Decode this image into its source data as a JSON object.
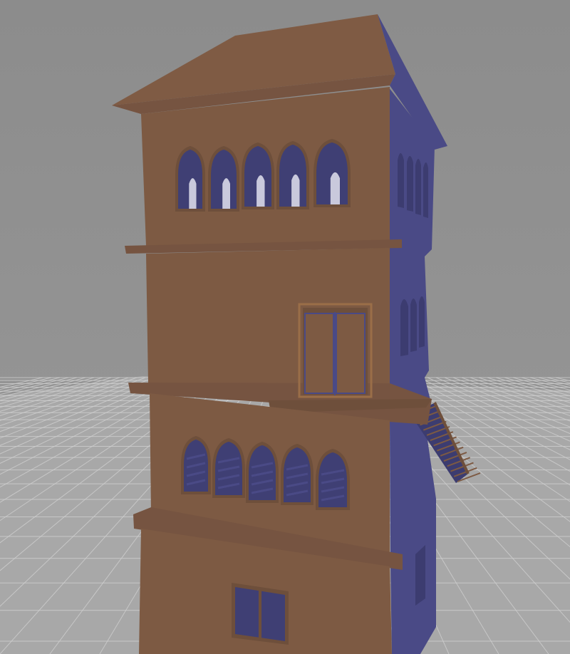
{
  "scene": {
    "subject": "medieval-tower-3d-model",
    "colors": {
      "sky_top": "#8c8c8c",
      "sky_bottom": "#999999",
      "floor": "#a8a8a8",
      "grid_line": "#cfcfcf",
      "wall_front": "#7d5a43",
      "wall_front_dark": "#6e4f3b",
      "wall_side": "#4a4a86",
      "wall_side_dark": "#3c3c70",
      "roof_top": "#7f5b44",
      "trim": "#765441",
      "opening_interior": "#3f3f74",
      "door_frame": "#9a6e48"
    }
  }
}
